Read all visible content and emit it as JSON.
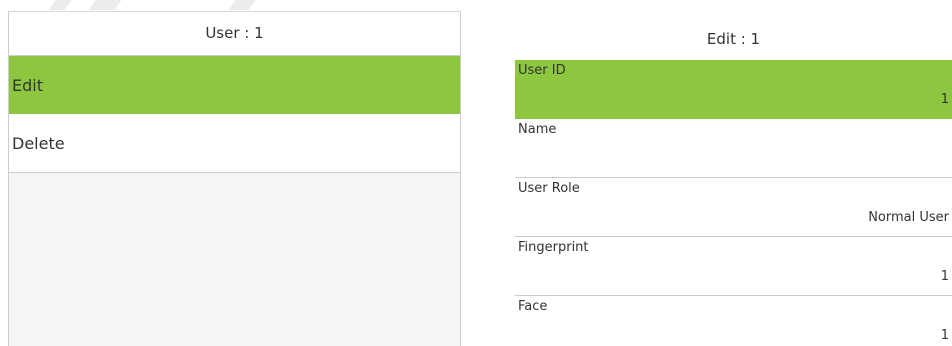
{
  "left_panel": {
    "title": "User : 1",
    "menu": [
      {
        "label": "Edit",
        "selected": true
      },
      {
        "label": "Delete",
        "selected": false
      }
    ]
  },
  "right_panel": {
    "title": "Edit : 1",
    "fields": [
      {
        "label": "User ID",
        "value": "1"
      },
      {
        "label": "Name",
        "value": ""
      },
      {
        "label": "User Role",
        "value": "Normal User"
      },
      {
        "label": "Fingerprint",
        "value": "1"
      },
      {
        "label": "Face",
        "value": "1"
      }
    ]
  },
  "colors": {
    "highlight": "#8dc63f",
    "divider": "#cccccc",
    "text": "#333333"
  }
}
